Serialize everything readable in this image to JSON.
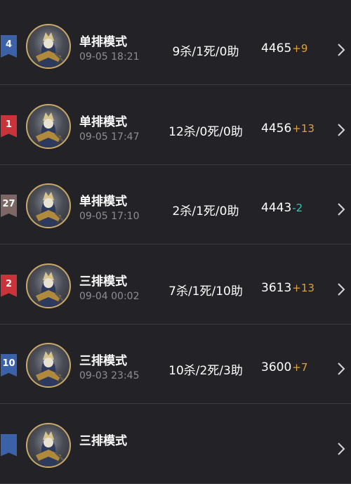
{
  "matches": [
    {
      "rank": "4",
      "rank_color": "#3b62a8",
      "mode": "单排模式",
      "time": "09-05 18:21",
      "kda": "9杀/1死/0助",
      "score": "4465",
      "delta": "+9",
      "delta_color": "#e0a23a"
    },
    {
      "rank": "1",
      "rank_color": "#c9343a",
      "mode": "单排模式",
      "time": "09-05 17:47",
      "kda": "12杀/0死/0助",
      "score": "4456",
      "delta": "+13",
      "delta_color": "#e0a23a"
    },
    {
      "rank": "27",
      "rank_color": "#7d6764",
      "mode": "单排模式",
      "time": "09-05 17:10",
      "kda": "2杀/1死/0助",
      "score": "4443",
      "delta": "-2",
      "delta_color": "#3cc3b6"
    },
    {
      "rank": "2",
      "rank_color": "#c9343a",
      "mode": "三排模式",
      "time": "09-04 00:02",
      "kda": "7杀/1死/10助",
      "score": "3613",
      "delta": "+13",
      "delta_color": "#e0a23a"
    },
    {
      "rank": "10",
      "rank_color": "#3b62a8",
      "mode": "三排模式",
      "time": "09-03 23:45",
      "kda": "10杀/2死/3助",
      "score": "3600",
      "delta": "+7",
      "delta_color": "#e0a23a"
    },
    {
      "rank": "",
      "rank_color": "#3b62a8",
      "mode": "三排模式",
      "time": "",
      "kda": "",
      "score": "",
      "delta": "",
      "delta_color": "#e0a23a"
    }
  ]
}
